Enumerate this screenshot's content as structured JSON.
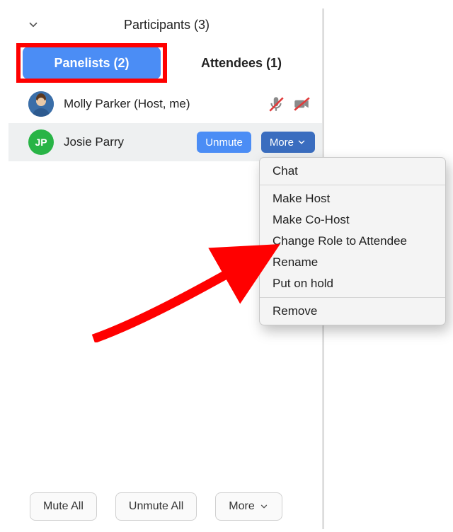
{
  "header": {
    "title": "Participants (3)"
  },
  "tabs": {
    "panelists": "Panelists (2)",
    "attendees": "Attendees (1)"
  },
  "participants": [
    {
      "initials": "",
      "name": "Molly Parker (Host, me)",
      "avatar_color": "#3a6ea8",
      "mic_muted": true,
      "cam_muted": true
    },
    {
      "initials": "JP",
      "name": "Josie Parry",
      "avatar_color": "#28b446",
      "unmute_label": "Unmute",
      "more_label": "More"
    }
  ],
  "menu": {
    "items_group1": [
      "Chat"
    ],
    "items_group2": [
      "Make Host",
      "Make Co-Host",
      "Change Role to Attendee",
      "Rename",
      "Put on hold"
    ],
    "items_group3": [
      "Remove"
    ]
  },
  "bottom": {
    "mute_all": "Mute All",
    "unmute_all": "Unmute All",
    "more": "More"
  }
}
